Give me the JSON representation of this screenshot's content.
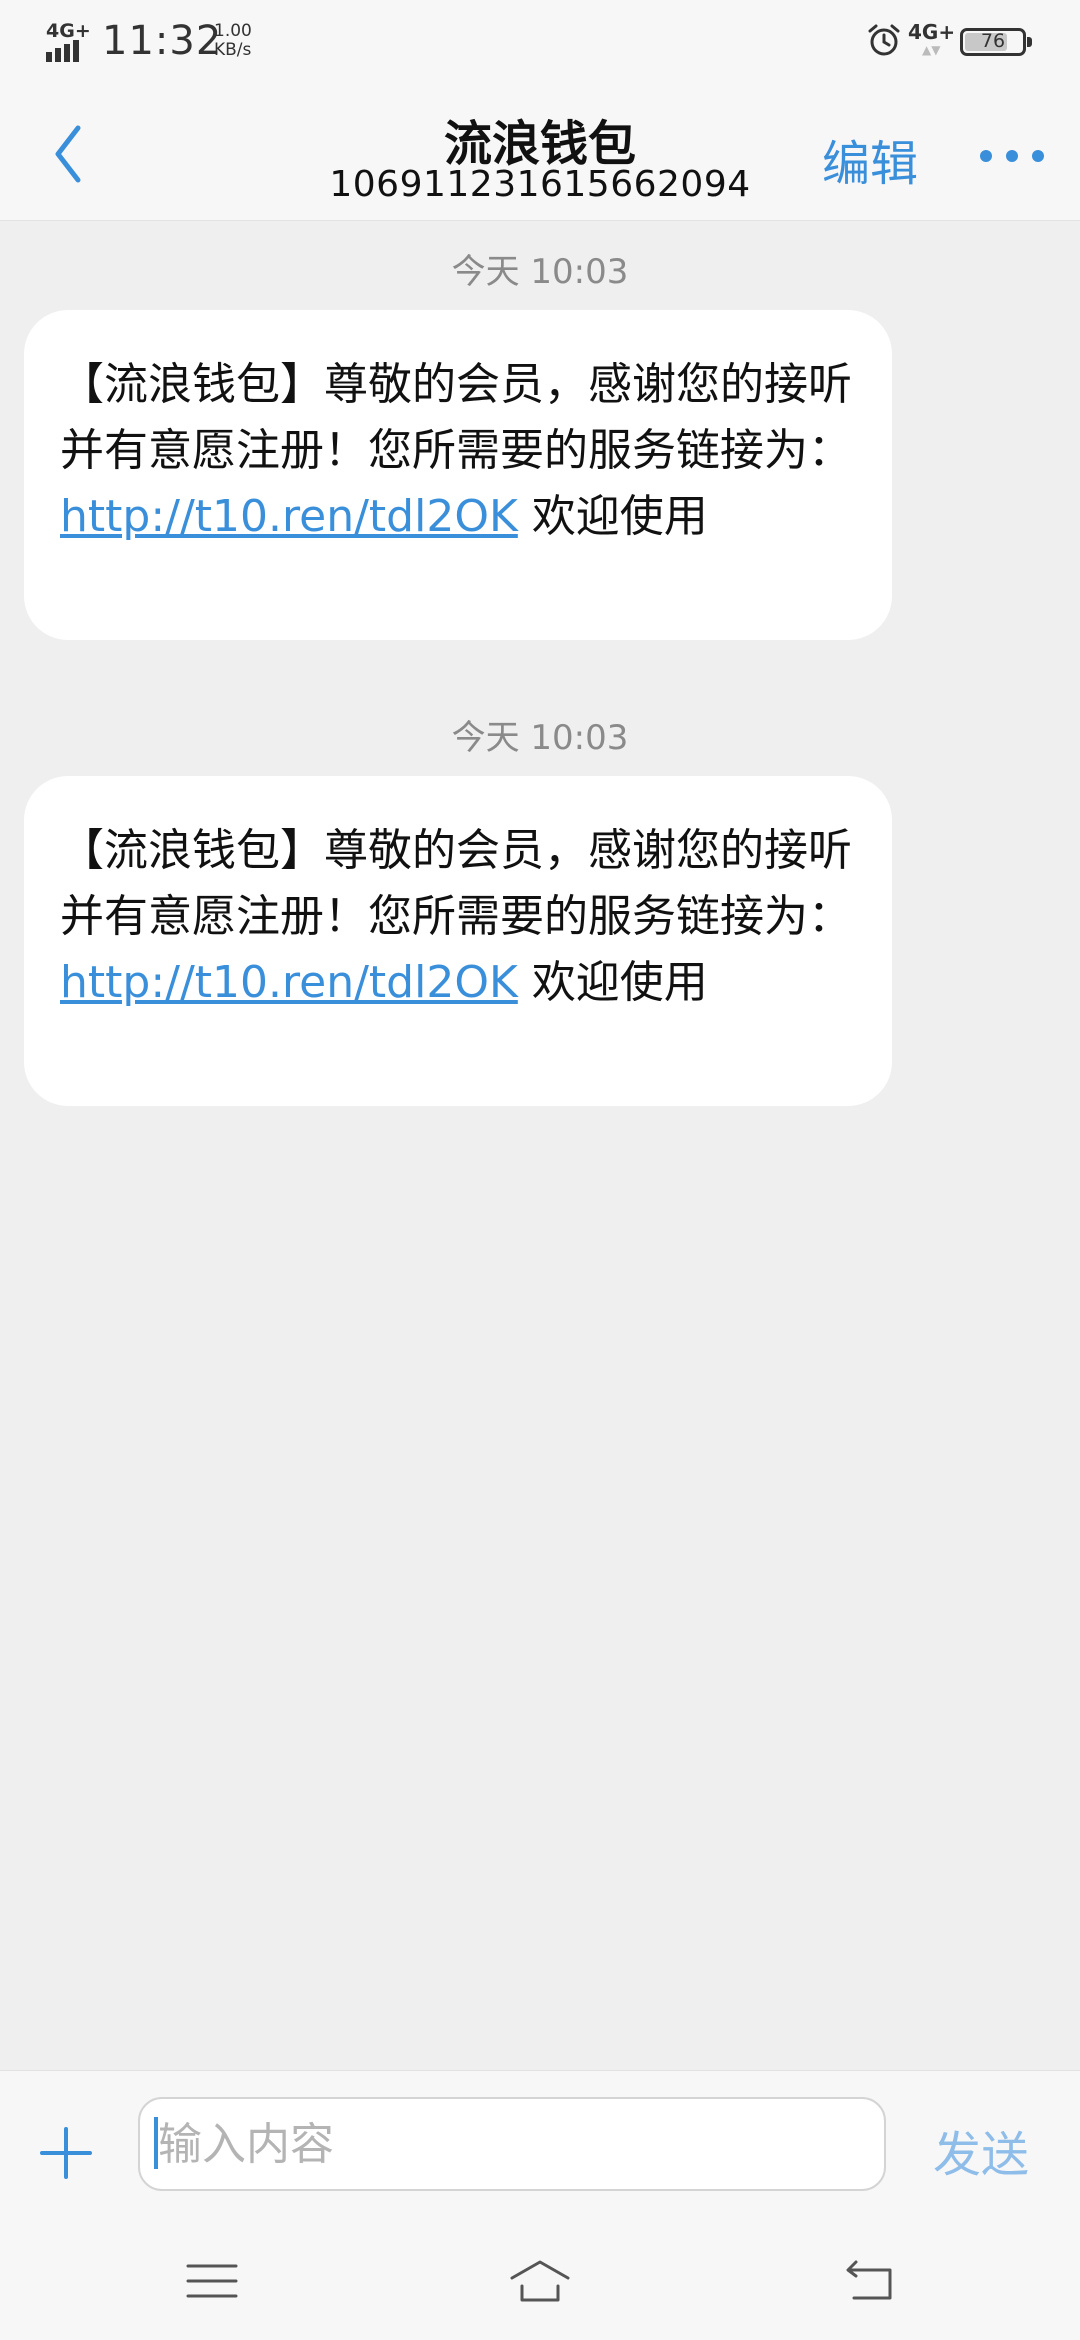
{
  "status_bar": {
    "network_left": "4G+",
    "time": "11:32",
    "speed_value": "1.00",
    "speed_unit": "KB/s",
    "network_right": "4G+",
    "battery_level": "76",
    "icons": [
      "signal-icon",
      "alarm-icon",
      "network-icon",
      "battery-icon"
    ]
  },
  "header": {
    "title": "流浪钱包",
    "subtitle": "106911231615662094",
    "edit_label": "编辑",
    "icons": [
      "back-chevron-icon",
      "more-dots-icon"
    ]
  },
  "messages": [
    {
      "timestamp": "今天 10:03",
      "text_before": "【流浪钱包】尊敬的会员，感谢您的接听并有意愿注册！您所需要的服务链接为：",
      "link": "http://t10.ren/tdl2OK",
      "text_after": "欢迎使用"
    },
    {
      "timestamp": "今天 10:03",
      "text_before": "【流浪钱包】尊敬的会员，感谢您的接听并有意愿注册！您所需要的服务链接为：",
      "link": "http://t10.ren/tdl2OK",
      "text_after": "欢迎使用"
    }
  ],
  "input_bar": {
    "placeholder": "输入内容",
    "value": "",
    "send_label": "发送",
    "icons": [
      "plus-icon"
    ]
  },
  "nav_bar": {
    "icons": [
      "menu-icon",
      "home-icon",
      "back-icon"
    ]
  },
  "colors": {
    "accent": "#3a8fdb",
    "send_disabled": "#8fbde9",
    "background": "#efefef",
    "bar_background": "#f7f7f7",
    "bubble": "#ffffff",
    "timestamp": "#8a8a8a"
  }
}
